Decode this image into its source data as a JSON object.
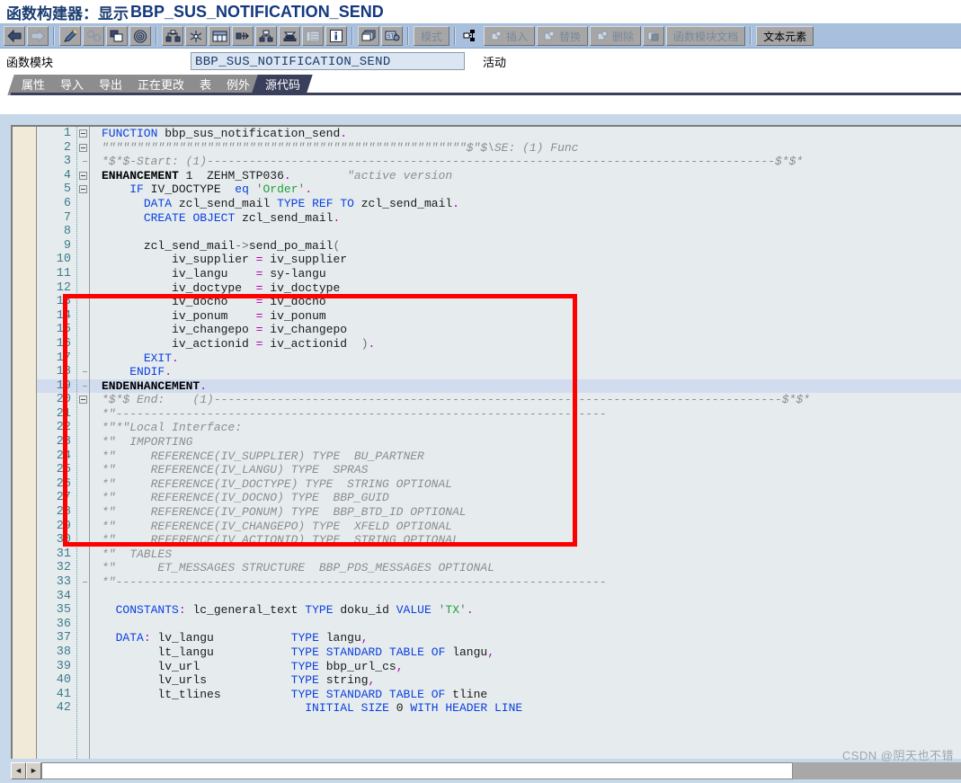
{
  "window": {
    "title_prefix": "函数构建器：显示",
    "title_object": "BBP_SUS_NOTIFICATION_SEND"
  },
  "toolbar": {
    "buttons": [
      {
        "name": "back-icon",
        "label": "",
        "enabled": true
      },
      {
        "name": "forward-icon",
        "label": "",
        "enabled": false
      },
      {
        "name": "pencil-edit-icon",
        "label": "",
        "enabled": true
      },
      {
        "name": "check-syntax-icon",
        "label": "",
        "enabled": false
      },
      {
        "name": "copy-icon",
        "label": "",
        "enabled": true
      },
      {
        "name": "where-used-icon",
        "label": "",
        "enabled": true
      },
      {
        "name": "navigation-icon",
        "label": "",
        "enabled": true
      },
      {
        "name": "pretty-printer-icon",
        "label": "",
        "enabled": true
      },
      {
        "name": "table-display-icon",
        "label": "",
        "enabled": true
      },
      {
        "name": "expand-icon",
        "label": "",
        "enabled": true
      },
      {
        "name": "hierarchy-icon",
        "label": "",
        "enabled": true
      },
      {
        "name": "stack-icon",
        "label": "",
        "enabled": true
      },
      {
        "name": "list-icon",
        "label": "",
        "enabled": false
      },
      {
        "name": "info-icon",
        "label": "",
        "enabled": true
      },
      {
        "name": "multi-window-icon",
        "label": "",
        "enabled": true
      },
      {
        "name": "debug-icon",
        "label": "",
        "enabled": true
      }
    ],
    "mode_label": "模式",
    "enhance-icon_label": "",
    "insert_label": "插入",
    "replace_label": "替换",
    "delete_label": "删除",
    "fm_doc_label": "函数模块文档",
    "text_elements_label": "文本元素"
  },
  "field_row": {
    "label": "函数模块",
    "value": "BBP_SUS_NOTIFICATION_SEND",
    "status": "活动"
  },
  "tabs": [
    {
      "label": "属性",
      "active": false
    },
    {
      "label": "导入",
      "active": false
    },
    {
      "label": "导出",
      "active": false
    },
    {
      "label": "正在更改",
      "active": false
    },
    {
      "label": "表",
      "active": false
    },
    {
      "label": "例外",
      "active": false
    },
    {
      "label": "源代码",
      "active": true
    }
  ],
  "editor": {
    "first_line": 1,
    "highlighted_line": 19,
    "annotation_box": {
      "color": "#ff0000",
      "from_line": 3,
      "to_line": 20
    },
    "lines": [
      {
        "n": 1,
        "fold": "minus",
        "text": "FUNCTION bbp_sus_notification_send."
      },
      {
        "n": 2,
        "fold": "minus",
        "text": "\"\"\"\"\"\"\"\"\"\"\"\"\"\"\"\"\"\"\"\"\"\"\"\"\"\"\"\"\"\"\"\"\"\"\"\"\"\"\"\"\"\"\"\"\"\"\"\"\"\"\"\"$\"$\\SE: (1) Func"
      },
      {
        "n": 3,
        "fold": "tick",
        "text": "*$*$-Start: (1)---------------------------------------------------------------------------------$*$*"
      },
      {
        "n": 4,
        "fold": "minus",
        "text": "ENHANCEMENT 1  ZEHM_STP036.        \"active version"
      },
      {
        "n": 5,
        "fold": "minus",
        "text": "    IF IV_DOCTYPE  eq 'Order'."
      },
      {
        "n": 6,
        "fold": "",
        "text": "      DATA zcl_send_mail TYPE REF TO zcl_send_mail."
      },
      {
        "n": 7,
        "fold": "",
        "text": "      CREATE OBJECT zcl_send_mail."
      },
      {
        "n": 8,
        "fold": "",
        "text": ""
      },
      {
        "n": 9,
        "fold": "",
        "text": "      zcl_send_mail->send_po_mail("
      },
      {
        "n": 10,
        "fold": "",
        "text": "          iv_supplier = iv_supplier"
      },
      {
        "n": 11,
        "fold": "",
        "text": "          iv_langu    = sy-langu"
      },
      {
        "n": 12,
        "fold": "",
        "text": "          iv_doctype  = iv_doctype"
      },
      {
        "n": 13,
        "fold": "",
        "text": "          iv_docno    = iv_docno"
      },
      {
        "n": 14,
        "fold": "",
        "text": "          iv_ponum    = iv_ponum"
      },
      {
        "n": 15,
        "fold": "",
        "text": "          iv_changepo = iv_changepo"
      },
      {
        "n": 16,
        "fold": "",
        "text": "          iv_actionid = iv_actionid  )."
      },
      {
        "n": 17,
        "fold": "",
        "text": "      EXIT."
      },
      {
        "n": 18,
        "fold": "tick",
        "text": "    ENDIF."
      },
      {
        "n": 19,
        "fold": "tick",
        "text": "ENDENHANCEMENT."
      },
      {
        "n": 20,
        "fold": "minus",
        "text": "*$*$ End:    (1)---------------------------------------------------------------------------------$*$*"
      },
      {
        "n": 21,
        "fold": "",
        "text": "*\"----------------------------------------------------------------------"
      },
      {
        "n": 22,
        "fold": "",
        "text": "*\"*\"Local Interface:"
      },
      {
        "n": 23,
        "fold": "",
        "text": "*\"  IMPORTING"
      },
      {
        "n": 24,
        "fold": "",
        "text": "*\"     REFERENCE(IV_SUPPLIER) TYPE  BU_PARTNER"
      },
      {
        "n": 25,
        "fold": "",
        "text": "*\"     REFERENCE(IV_LANGU) TYPE  SPRAS"
      },
      {
        "n": 26,
        "fold": "",
        "text": "*\"     REFERENCE(IV_DOCTYPE) TYPE  STRING OPTIONAL"
      },
      {
        "n": 27,
        "fold": "",
        "text": "*\"     REFERENCE(IV_DOCNO) TYPE  BBP_GUID"
      },
      {
        "n": 28,
        "fold": "",
        "text": "*\"     REFERENCE(IV_PONUM) TYPE  BBP_BTD_ID OPTIONAL"
      },
      {
        "n": 29,
        "fold": "",
        "text": "*\"     REFERENCE(IV_CHANGEPO) TYPE  XFELD OPTIONAL"
      },
      {
        "n": 30,
        "fold": "",
        "text": "*\"     REFERENCE(IV_ACTIONID) TYPE  STRING OPTIONAL"
      },
      {
        "n": 31,
        "fold": "",
        "text": "*\"  TABLES"
      },
      {
        "n": 32,
        "fold": "",
        "text": "*\"      ET_MESSAGES STRUCTURE  BBP_PDS_MESSAGES OPTIONAL"
      },
      {
        "n": 33,
        "fold": "tick",
        "text": "*\"----------------------------------------------------------------------"
      },
      {
        "n": 34,
        "fold": "",
        "text": ""
      },
      {
        "n": 35,
        "fold": "",
        "text": "  CONSTANTS: lc_general_text TYPE doku_id VALUE 'TX'."
      },
      {
        "n": 36,
        "fold": "",
        "text": ""
      },
      {
        "n": 37,
        "fold": "",
        "text": "  DATA: lv_langu           TYPE langu,"
      },
      {
        "n": 38,
        "fold": "",
        "text": "        lt_langu           TYPE STANDARD TABLE OF langu,"
      },
      {
        "n": 39,
        "fold": "",
        "text": "        lv_url             TYPE bbp_url_cs,"
      },
      {
        "n": 40,
        "fold": "",
        "text": "        lv_urls            TYPE string,"
      },
      {
        "n": 41,
        "fold": "",
        "text": "        lt_tlines          TYPE STANDARD TABLE OF tline"
      },
      {
        "n": 42,
        "fold": "",
        "text": "                             INITIAL SIZE 0 WITH HEADER LINE"
      }
    ]
  },
  "scrollbar": {
    "left_arrow": "◄",
    "right_arrow": "►"
  },
  "watermark": "CSDN @阴天也不错",
  "colors": {
    "title_blue": "#14387f",
    "toolbar_bg": "#a8c0de",
    "work_bg": "#c6d8ea",
    "editor_bg": "#e6ecee",
    "left_strip": "#f2ead8",
    "line_number": "#3b7d8c",
    "keyword": "#0b3fe0",
    "comment": "#8d8d8d",
    "string": "#1f9e3a",
    "operator": "#b400b4",
    "annotation_red": "#ff0000",
    "tab_inactive": "#8d8d8d",
    "tab_active": "#3a3f5c",
    "current_line": "#d2dcef"
  }
}
